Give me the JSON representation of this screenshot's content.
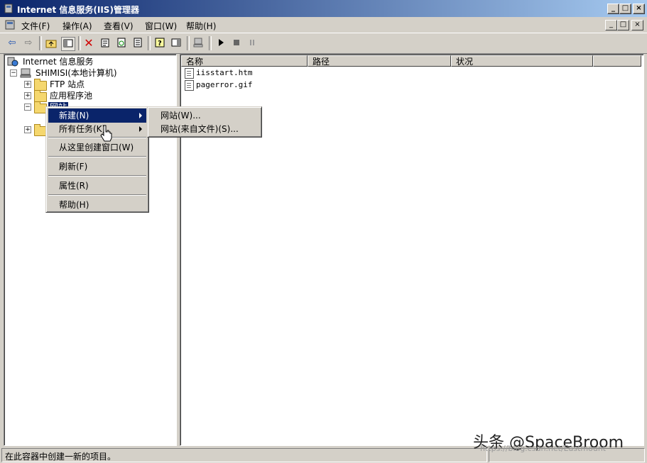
{
  "window": {
    "title": "Internet 信息服务(IIS)管理器",
    "buttons": {
      "minimize": "_",
      "maximize": "□",
      "close": "×"
    }
  },
  "menubar": {
    "items": [
      "文件(F)",
      "操作(A)",
      "查看(V)",
      "窗口(W)",
      "帮助(H)"
    ]
  },
  "tree": {
    "root": "Internet 信息服务",
    "computer": "SHIMISI(本地计算机)",
    "ftp": "FTP 站点",
    "apppool": "应用程序池",
    "websites": "网站"
  },
  "list": {
    "columns": [
      "名称",
      "路径",
      "状况"
    ],
    "files": [
      "iisstart.htm",
      "pagerror.gif"
    ]
  },
  "context_menu": {
    "items": [
      "新建(N)",
      "所有任务(K)",
      "从这里创建窗口(W)",
      "刷新(F)",
      "属性(R)",
      "帮助(H)"
    ],
    "selected": "新建(N)"
  },
  "submenu": {
    "items": [
      "网站(W)...",
      "网站(来自文件)(S)..."
    ]
  },
  "statusbar": {
    "text": "在此容器中创建一新的项目。"
  },
  "watermark": {
    "text": "头条 @SpaceBroom",
    "url": "https://blog.csdn.net/Eastmount"
  },
  "colors": {
    "titlebar": "#0a246a",
    "selection": "#0a246a",
    "face": "#d4d0c8"
  }
}
